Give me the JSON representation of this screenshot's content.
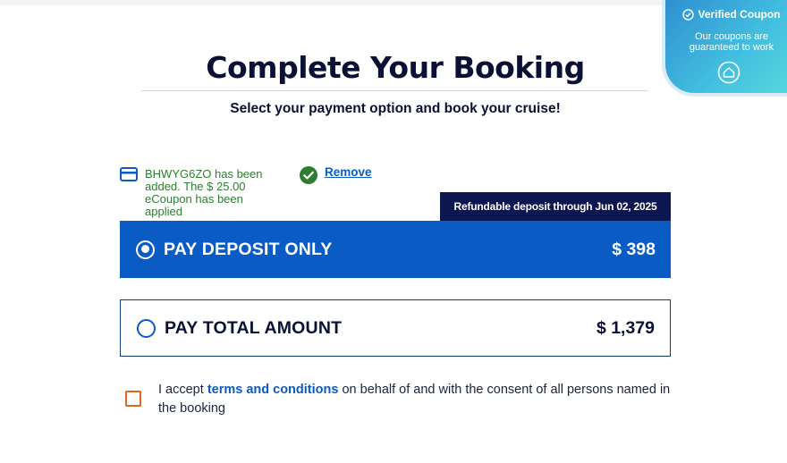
{
  "coupon_badge": {
    "title": "Verified Coupon",
    "subtitle": "Our coupons are guaranteed to work"
  },
  "header": {
    "title": "Complete Your Booking",
    "subtitle": "Select your payment option and book your cruise!"
  },
  "coupon": {
    "message": "BHWYG6ZO has been added. The $ 25.00 eCoupon has been applied",
    "remove_label": "Remove"
  },
  "deposit_tag": "Refundable deposit through Jun 02, 2025",
  "payment_options": [
    {
      "label": "PAY DEPOSIT ONLY",
      "price": "$ 398",
      "selected": true
    },
    {
      "label": "PAY TOTAL AMOUNT",
      "price": "$ 1,379",
      "selected": false
    }
  ],
  "terms": {
    "prefix": "I accept ",
    "link": "terms and conditions",
    "suffix": " on behalf of and with the consent of all persons named in the booking",
    "checked": false
  },
  "colors": {
    "primary": "#0a5bc4",
    "navy": "#0c1650",
    "success": "#2e7d32",
    "checkbox_border": "#e0661c"
  },
  "icons": [
    "check-circle-icon",
    "home-icon",
    "credit-card-icon",
    "check-icon"
  ]
}
